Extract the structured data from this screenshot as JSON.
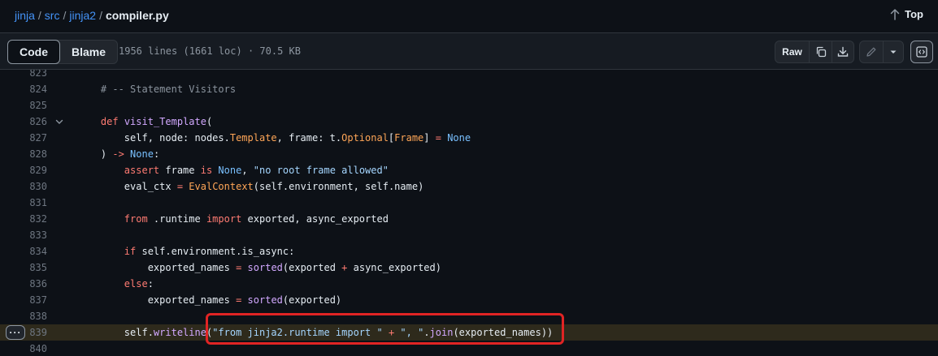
{
  "breadcrumb": {
    "parts": [
      "jinja",
      "src",
      "jinja2"
    ],
    "separator": "/",
    "current": "compiler.py"
  },
  "top_link": {
    "label": "Top"
  },
  "toolbar": {
    "tabs": [
      {
        "label": "Code",
        "active": true
      },
      {
        "label": "Blame",
        "active": false
      }
    ],
    "file_info": "1956 lines (1661 loc) · 70.5 KB",
    "raw_label": "Raw",
    "icons": [
      "copy-icon",
      "download-icon",
      "pencil-icon",
      "triangle-down-icon",
      "code-square-icon"
    ]
  },
  "code": {
    "lines": [
      {
        "num": "823",
        "text": ""
      },
      {
        "num": "824",
        "text": "    # -- Statement Visitors"
      },
      {
        "num": "825",
        "text": ""
      },
      {
        "num": "826",
        "text": "    def visit_Template(",
        "foldable": true
      },
      {
        "num": "827",
        "text": "        self, node: nodes.Template, frame: t.Optional[Frame] = None"
      },
      {
        "num": "828",
        "text": "    ) -> None:"
      },
      {
        "num": "829",
        "text": "        assert frame is None, \"no root frame allowed\""
      },
      {
        "num": "830",
        "text": "        eval_ctx = EvalContext(self.environment, self.name)"
      },
      {
        "num": "831",
        "text": ""
      },
      {
        "num": "832",
        "text": "        from .runtime import exported, async_exported"
      },
      {
        "num": "833",
        "text": ""
      },
      {
        "num": "834",
        "text": "        if self.environment.is_async:"
      },
      {
        "num": "835",
        "text": "            exported_names = sorted(exported + async_exported)"
      },
      {
        "num": "836",
        "text": "        else:"
      },
      {
        "num": "837",
        "text": "            exported_names = sorted(exported)"
      },
      {
        "num": "838",
        "text": ""
      },
      {
        "num": "839",
        "text": "        self.writeline(\"from jinja2.runtime import \" + \", \".join(exported_names))",
        "highlighted": true
      },
      {
        "num": "840",
        "text": ""
      }
    ]
  },
  "colors": {
    "background": "#0d1117",
    "link": "#4493f8",
    "highlight_border": "#e02424",
    "keyword": "#ff7b72",
    "string": "#a5d6ff"
  }
}
